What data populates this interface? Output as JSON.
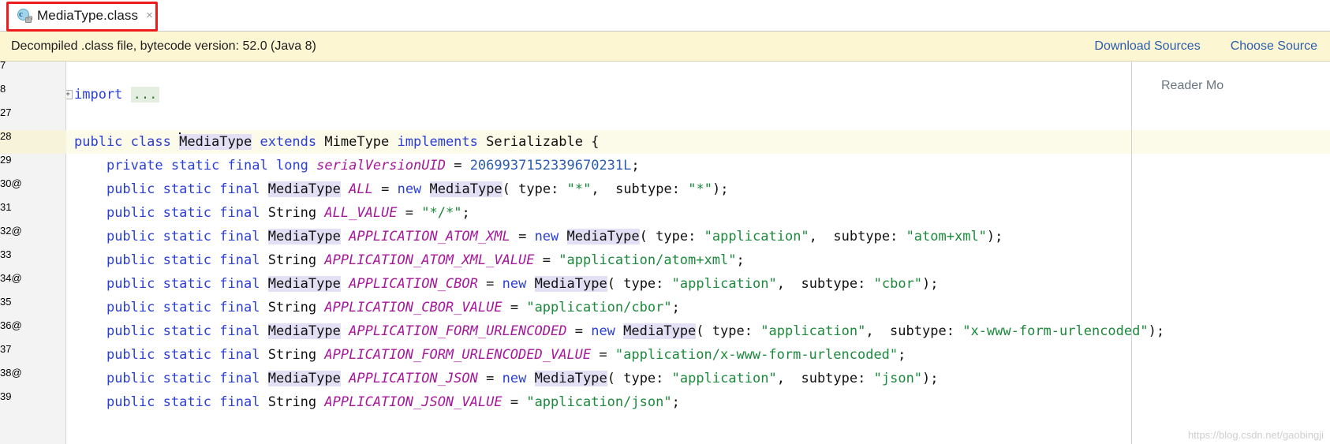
{
  "tab": {
    "title": "MediaType.class",
    "close_label": "×",
    "icon": "java-class-locked-icon",
    "highlight_color": "#ee1c1c",
    "underline_color": "#3b7bbf"
  },
  "banner": {
    "message": "Decompiled .class file, bytecode version: 52.0 (Java 8)",
    "background": "#fdf6d3",
    "links": [
      {
        "label": "Download Sources"
      },
      {
        "label": "Choose Source"
      }
    ]
  },
  "right_panel": {
    "reader_mode_label": "Reader Mo"
  },
  "watermark": "https://blog.csdn.net/gaobingji",
  "editor": {
    "caret_line": 28,
    "lines": [
      {
        "num": "7",
        "at": "",
        "caret": false
      },
      {
        "num": "8",
        "at": "",
        "caret": false
      },
      {
        "num": "27",
        "at": "",
        "caret": false
      },
      {
        "num": "28",
        "at": "",
        "caret": true
      },
      {
        "num": "29",
        "at": "",
        "caret": false
      },
      {
        "num": "30",
        "at": "@",
        "caret": false
      },
      {
        "num": "31",
        "at": "",
        "caret": false
      },
      {
        "num": "32",
        "at": "@",
        "caret": false
      },
      {
        "num": "33",
        "at": "",
        "caret": false
      },
      {
        "num": "34",
        "at": "@",
        "caret": false
      },
      {
        "num": "35",
        "at": "",
        "caret": false
      },
      {
        "num": "36",
        "at": "@",
        "caret": false
      },
      {
        "num": "37",
        "at": "",
        "caret": false
      },
      {
        "num": "38",
        "at": "@",
        "caret": false
      },
      {
        "num": "39",
        "at": "",
        "caret": false
      }
    ],
    "code_lines": [
      {
        "num": "7",
        "text": ""
      },
      {
        "num": "8",
        "text": "import ..."
      },
      {
        "num": "27",
        "text": ""
      },
      {
        "num": "28",
        "text": "public class MediaType extends MimeType implements Serializable {"
      },
      {
        "num": "29",
        "text": "    private static final long serialVersionUID = 2069937152339670231L;"
      },
      {
        "num": "30",
        "text": "    public static final MediaType ALL = new MediaType( type: \"*\",  subtype: \"*\");"
      },
      {
        "num": "31",
        "text": "    public static final String ALL_VALUE = \"*/*\";"
      },
      {
        "num": "32",
        "text": "    public static final MediaType APPLICATION_ATOM_XML = new MediaType( type: \"application\",  subtype: \"atom+xml\");"
      },
      {
        "num": "33",
        "text": "    public static final String APPLICATION_ATOM_XML_VALUE = \"application/atom+xml\";"
      },
      {
        "num": "34",
        "text": "    public static final MediaType APPLICATION_CBOR = new MediaType( type: \"application\",  subtype: \"cbor\");"
      },
      {
        "num": "35",
        "text": "    public static final String APPLICATION_CBOR_VALUE = \"application/cbor\";"
      },
      {
        "num": "36",
        "text": "    public static final MediaType APPLICATION_FORM_URLENCODED = new MediaType( type: \"application\",  subtype: \"x-www-form-urlencoded\");"
      },
      {
        "num": "37",
        "text": "    public static final String APPLICATION_FORM_URLENCODED_VALUE = \"application/x-www-form-urlencoded\";"
      },
      {
        "num": "38",
        "text": "    public static final MediaType APPLICATION_JSON = new MediaType( type: \"application\",  subtype: \"json\");"
      },
      {
        "num": "39",
        "text": "    public static final String APPLICATION_JSON_VALUE = \"application/json\";"
      }
    ],
    "fold_marker": "+",
    "import_fold_text": "...",
    "highlight_token": "MediaType",
    "hint_labels": [
      "type:",
      "subtype:"
    ],
    "colors": {
      "keyword": "#2a3fd8",
      "string": "#1c8a3c",
      "number": "#2a5db0",
      "field": "#a6179a",
      "type": "#111111",
      "search_highlight": "#e3e0f5",
      "caret_line_bg": "#fcfae8"
    }
  }
}
